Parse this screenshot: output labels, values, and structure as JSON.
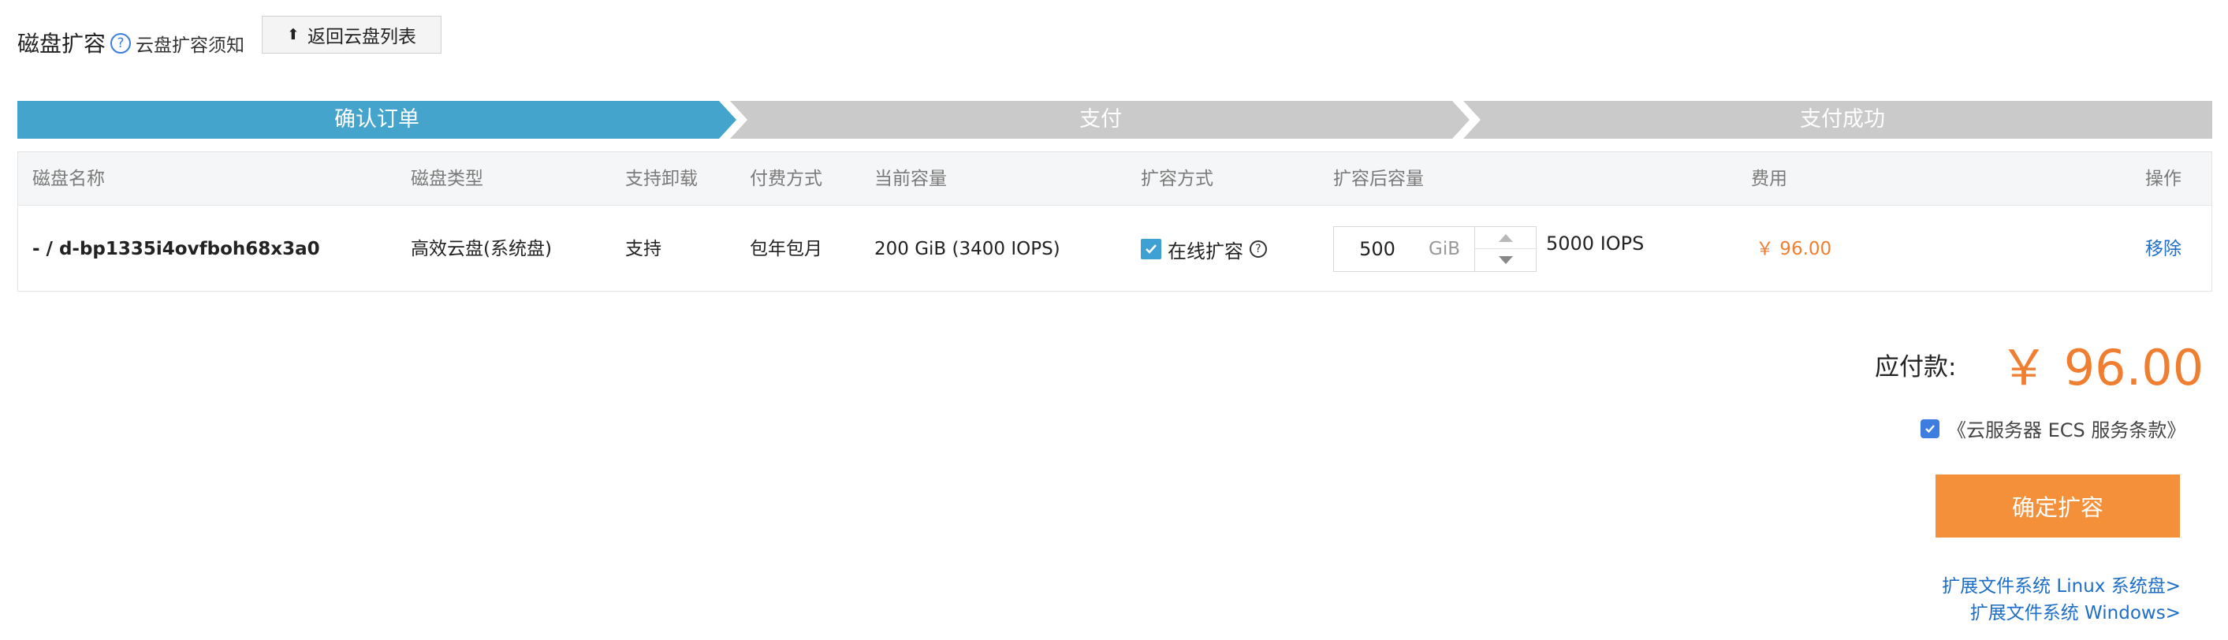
{
  "header": {
    "title": "磁盘扩容",
    "help_text": "云盘扩容须知",
    "back_label": "返回云盘列表"
  },
  "steps": [
    "确认订单",
    "支付",
    "支付成功"
  ],
  "colors": {
    "active_step": "#45a4cc",
    "inactive_step": "#cacaca",
    "accent": "#f07e30",
    "button": "#f5903a",
    "link": "#1e6ec8"
  },
  "table": {
    "headers": [
      "磁盘名称",
      "磁盘类型",
      "支持卸载",
      "付费方式",
      "当前容量",
      "扩容方式",
      "扩容后容量",
      "费用",
      "操作"
    ],
    "row": {
      "name": "- / d-bp1335i4ovfboh68x3a0",
      "type": "高效云盘(系统盘)",
      "detachable": "支持",
      "billing": "包年包月",
      "current": "200 GiB (3400 IOPS)",
      "method": "在线扩容",
      "new_size": "500",
      "unit": "GiB",
      "new_iops": "5000 IOPS",
      "fee": "￥ 96.00",
      "action": "移除"
    }
  },
  "summary": {
    "pay_label": "应付款:",
    "amount": "￥ 96.00",
    "agreement": "《云服务器 ECS 服务条款》",
    "confirm": "确定扩容",
    "link_linux": "扩展文件系统 Linux 系统盘>",
    "link_windows": "扩展文件系统 Windows>"
  }
}
